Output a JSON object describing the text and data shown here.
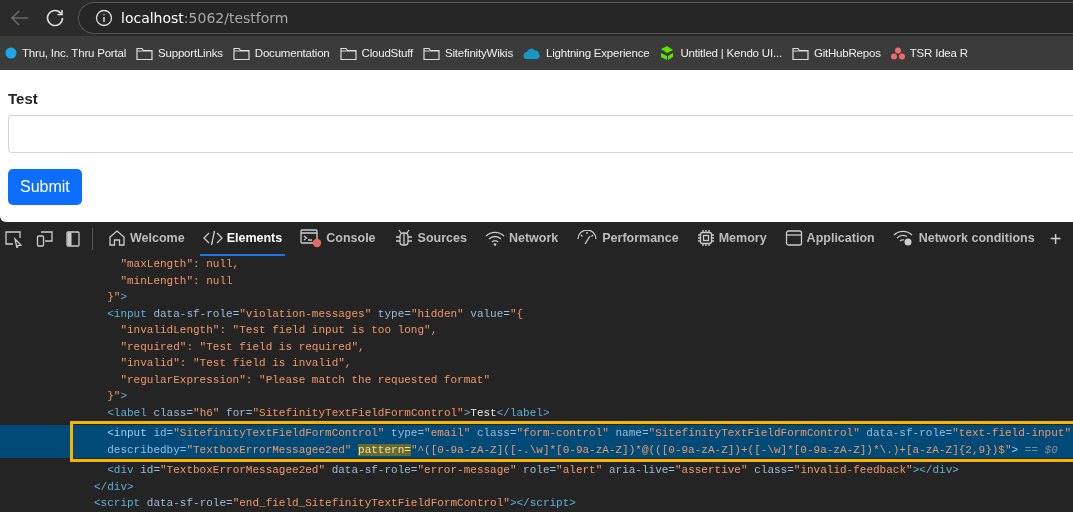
{
  "browser": {
    "back_disabled": true,
    "url_host": "localhost",
    "url_path": ":5062/testform"
  },
  "bookmarks": [
    {
      "kind": "dot",
      "color": "#1ea8ec",
      "label": "Thru, Inc. Thru Portal"
    },
    {
      "kind": "folder",
      "label": "SupportLinks"
    },
    {
      "kind": "folder",
      "label": "Documentation"
    },
    {
      "kind": "folder",
      "label": "CloudStuff"
    },
    {
      "kind": "folder",
      "label": "SitefinityWikis"
    },
    {
      "kind": "cloud",
      "color": "#1798c1",
      "label": "Lightning Experience"
    },
    {
      "kind": "chevron",
      "color": "#5ce500",
      "label": "Untitled | Kendo UI..."
    },
    {
      "kind": "folder",
      "label": "GitHubRepos"
    },
    {
      "kind": "dots",
      "color": "#f06a6a",
      "label": "TSR Idea R"
    }
  ],
  "form": {
    "label": "Test",
    "submit": "Submit"
  },
  "devtools": {
    "tabs": [
      {
        "kind": "home",
        "label": "Welcome",
        "selected": false
      },
      {
        "kind": "code",
        "label": "Elements",
        "selected": true
      },
      {
        "kind": "console",
        "label": "Console",
        "selected": false
      },
      {
        "kind": "bug",
        "label": "Sources",
        "selected": false
      },
      {
        "kind": "wifi",
        "label": "Network",
        "selected": false
      },
      {
        "kind": "gauge",
        "label": "Performance",
        "selected": false
      },
      {
        "kind": "chip",
        "label": "Memory",
        "selected": false
      },
      {
        "kind": "window",
        "label": "Application",
        "selected": false
      },
      {
        "kind": "wifigear",
        "label": "Network conditions",
        "selected": false
      }
    ],
    "add_tab": "+",
    "lines": [
      {
        "selected": false,
        "tokens": [
          {
            "kind": "value",
            "text": "    \"maxLength\": null,"
          }
        ]
      },
      {
        "selected": false,
        "tokens": [
          {
            "kind": "value",
            "text": "    \"minLength\": null"
          }
        ]
      },
      {
        "selected": false,
        "tokens": [
          {
            "kind": "value",
            "text": "  }\""
          },
          {
            "kind": "tag",
            "text": ">"
          }
        ]
      },
      {
        "selected": false,
        "tokens": [
          {
            "kind": "tag",
            "text": "  <input"
          },
          {
            "kind": "attr",
            "text": " data-sf-role="
          },
          {
            "kind": "value",
            "text": "\"violation-messages\""
          },
          {
            "kind": "attr",
            "text": " type="
          },
          {
            "kind": "value",
            "text": "\"hidden\""
          },
          {
            "kind": "attr",
            "text": " value="
          },
          {
            "kind": "value",
            "text": "\"{"
          }
        ]
      },
      {
        "selected": false,
        "tokens": [
          {
            "kind": "value",
            "text": "    \"invalidLength\": \"Test field input is too long\","
          }
        ]
      },
      {
        "selected": false,
        "tokens": [
          {
            "kind": "value",
            "text": "    \"required\": \"Test field is required\","
          }
        ]
      },
      {
        "selected": false,
        "tokens": [
          {
            "kind": "value",
            "text": "    \"invalid\": \"Test field is invalid\","
          }
        ]
      },
      {
        "selected": false,
        "tokens": [
          {
            "kind": "value",
            "text": "    \"regularExpression\": \"Please match the requested format\""
          }
        ]
      },
      {
        "selected": false,
        "tokens": [
          {
            "kind": "value",
            "text": "  }\""
          },
          {
            "kind": "tag",
            "text": ">"
          }
        ]
      },
      {
        "selected": false,
        "tokens": [
          {
            "kind": "tag",
            "text": "  <label"
          },
          {
            "kind": "attr",
            "text": " class="
          },
          {
            "kind": "value",
            "text": "\"h6\""
          },
          {
            "kind": "attr",
            "text": " for="
          },
          {
            "kind": "value",
            "text": "\"SitefinityTextFieldFormControl\""
          },
          {
            "kind": "tag",
            "text": ">"
          },
          {
            "kind": "text",
            "text": "Test"
          },
          {
            "kind": "tag",
            "text": "</label>"
          }
        ]
      },
      {
        "selected": true,
        "tokens": [
          {
            "kind": "tag",
            "text": "  <input"
          },
          {
            "kind": "attr",
            "text": " id="
          },
          {
            "kind": "value",
            "text": "\"SitefinityTextFieldFormControl\""
          },
          {
            "kind": "attr",
            "text": " type="
          },
          {
            "kind": "value",
            "text": "\"email\""
          },
          {
            "kind": "attr",
            "text": " class="
          },
          {
            "kind": "value",
            "text": "\"form-control\""
          },
          {
            "kind": "attr",
            "text": " name="
          },
          {
            "kind": "value",
            "text": "\"SitefinityTextFieldFormControl\""
          },
          {
            "kind": "attr",
            "text": " data-sf-role="
          },
          {
            "kind": "value",
            "text": "\"text-field-input\""
          }
        ]
      },
      {
        "selected": true,
        "tokens": [
          {
            "kind": "attr",
            "text": "  describedby="
          },
          {
            "kind": "value",
            "text": "\"TextboxErrorMessagee2ed\" "
          },
          {
            "kind": "match",
            "text": "pattern="
          },
          {
            "kind": "value",
            "text": "\"^([0-9a-zA-Z]([-.\\w]*[0-9a-zA-Z])*@(([0-9a-zA-Z])+([-\\w]*[0-9a-zA-Z])*\\.)+[a-zA-Z]{2,9})$\""
          },
          {
            "kind": "tag",
            "text": ">"
          },
          {
            "kind": "comment",
            "text": " == $0"
          }
        ]
      },
      {
        "selected": false,
        "tokens": [
          {
            "kind": "tag",
            "text": "  <div"
          },
          {
            "kind": "attr",
            "text": " id="
          },
          {
            "kind": "value",
            "text": "\"TextboxErrorMessagee2ed\""
          },
          {
            "kind": "attr",
            "text": " data-sf-role="
          },
          {
            "kind": "value",
            "text": "\"error-message\""
          },
          {
            "kind": "attr",
            "text": " role="
          },
          {
            "kind": "value",
            "text": "\"alert\""
          },
          {
            "kind": "attr",
            "text": " aria-live="
          },
          {
            "kind": "value",
            "text": "\"assertive\""
          },
          {
            "kind": "attr",
            "text": " class="
          },
          {
            "kind": "value",
            "text": "\"invalid-feedback\""
          },
          {
            "kind": "tag",
            "text": "></div>"
          }
        ]
      },
      {
        "selected": false,
        "tokens": [
          {
            "kind": "tag",
            "text": "</div>"
          }
        ]
      },
      {
        "selected": false,
        "tokens": [
          {
            "kind": "tag",
            "text": "<script"
          },
          {
            "kind": "attr",
            "text": " data-sf-role="
          },
          {
            "kind": "value",
            "text": "\"end_field_SitefinityTextFieldFormControl\""
          },
          {
            "kind": "tag",
            "text": "></script>"
          }
        ]
      }
    ]
  }
}
